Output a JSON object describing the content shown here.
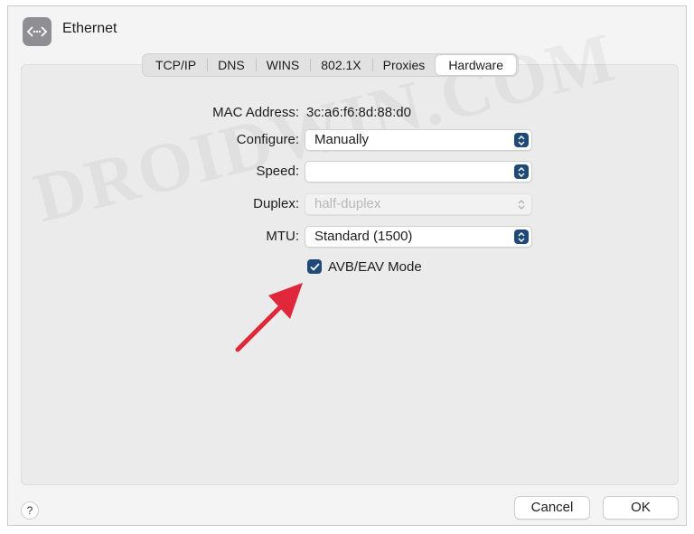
{
  "window": {
    "title": "Ethernet",
    "app_icon": "ethernet-icon"
  },
  "tabs": [
    {
      "label": "TCP/IP",
      "active": false
    },
    {
      "label": "DNS",
      "active": false
    },
    {
      "label": "WINS",
      "active": false
    },
    {
      "label": "802.1X",
      "active": false
    },
    {
      "label": "Proxies",
      "active": false
    },
    {
      "label": "Hardware",
      "active": true
    }
  ],
  "hardware": {
    "mac_address": {
      "label": "MAC Address:",
      "value": "3c:a6:f6:8d:88:d0"
    },
    "configure": {
      "label": "Configure:",
      "value": "Manually"
    },
    "speed": {
      "label": "Speed:",
      "value": ""
    },
    "duplex": {
      "label": "Duplex:",
      "value": "half-duplex",
      "disabled": true
    },
    "mtu": {
      "label": "MTU:",
      "value": "Standard (1500)"
    },
    "avb_mode": {
      "label": "AVB/EAV Mode",
      "checked": true
    }
  },
  "footer": {
    "help_label": "?",
    "cancel_label": "Cancel",
    "ok_label": "OK"
  },
  "watermark": "DROIDWIN.COM",
  "colors": {
    "accent": "#1f4a77",
    "annotation_arrow": "#e0283c"
  }
}
